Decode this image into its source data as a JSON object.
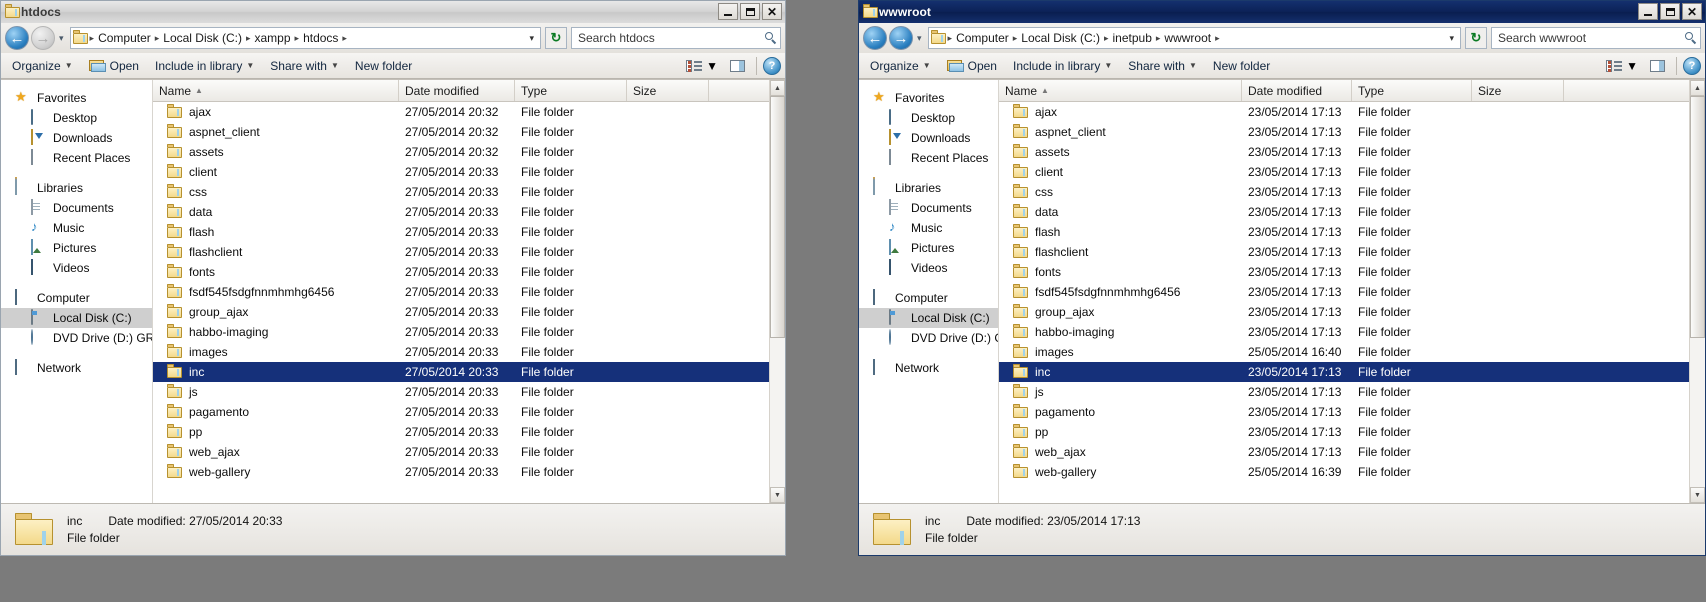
{
  "desktop": {
    "background": "#7b7b7b"
  },
  "windows": [
    {
      "id": "htdocs",
      "title": "htdocs",
      "active": false,
      "titlebar": {
        "minimize": "_",
        "maximize": "□",
        "close": "✕"
      },
      "address": {
        "back_label": "◀",
        "forward_label": "▶",
        "history_label": "▾",
        "crumbs": [
          "Computer",
          "Local Disk (C:)",
          "xampp",
          "htdocs"
        ],
        "separator": "▸",
        "dropdown_caret": "▾",
        "refresh_label": "↻"
      },
      "search": {
        "placeholder": "Search htdocs",
        "icon": "search-icon"
      },
      "toolbar": {
        "organize": "Organize",
        "open": "Open",
        "include_in_library": "Include in library",
        "share_with": "Share with",
        "new_folder": "New folder",
        "dropdown_caret": "▾",
        "view_icon": "view-list-icon",
        "preview_icon": "preview-pane-icon",
        "help_label": "?"
      },
      "navpane": {
        "groups": [
          {
            "name": "Favorites",
            "icon": "star-icon",
            "items": [
              {
                "label": "Desktop",
                "icon": "desktop-icon"
              },
              {
                "label": "Downloads",
                "icon": "downloads-icon"
              },
              {
                "label": "Recent Places",
                "icon": "recent-places-icon"
              }
            ]
          },
          {
            "name": "Libraries",
            "icon": "libraries-icon",
            "items": [
              {
                "label": "Documents",
                "icon": "documents-icon"
              },
              {
                "label": "Music",
                "icon": "music-icon"
              },
              {
                "label": "Pictures",
                "icon": "pictures-icon"
              },
              {
                "label": "Videos",
                "icon": "videos-icon"
              }
            ]
          },
          {
            "name": "Computer",
            "icon": "computer-icon",
            "items": [
              {
                "label": "Local Disk (C:)",
                "icon": "disk-icon",
                "selected": true
              },
              {
                "label": "DVD Drive (D:) GRMSX",
                "icon": "dvd-icon"
              }
            ]
          },
          {
            "name": "Network",
            "icon": "network-icon",
            "items": []
          }
        ]
      },
      "columns": [
        {
          "key": "name",
          "label": "Name",
          "sorted": true,
          "sort_arrow": "▲"
        },
        {
          "key": "date",
          "label": "Date modified"
        },
        {
          "key": "type",
          "label": "Type"
        },
        {
          "key": "size",
          "label": "Size"
        }
      ],
      "rows": [
        {
          "name": "ajax",
          "date": "27/05/2014 20:32",
          "type": "File folder",
          "size": ""
        },
        {
          "name": "aspnet_client",
          "date": "27/05/2014 20:32",
          "type": "File folder",
          "size": ""
        },
        {
          "name": "assets",
          "date": "27/05/2014 20:32",
          "type": "File folder",
          "size": ""
        },
        {
          "name": "client",
          "date": "27/05/2014 20:33",
          "type": "File folder",
          "size": ""
        },
        {
          "name": "css",
          "date": "27/05/2014 20:33",
          "type": "File folder",
          "size": ""
        },
        {
          "name": "data",
          "date": "27/05/2014 20:33",
          "type": "File folder",
          "size": ""
        },
        {
          "name": "flash",
          "date": "27/05/2014 20:33",
          "type": "File folder",
          "size": ""
        },
        {
          "name": "flashclient",
          "date": "27/05/2014 20:33",
          "type": "File folder",
          "size": ""
        },
        {
          "name": "fonts",
          "date": "27/05/2014 20:33",
          "type": "File folder",
          "size": ""
        },
        {
          "name": "fsdf545fsdgfnnmhmhg6456",
          "date": "27/05/2014 20:33",
          "type": "File folder",
          "size": ""
        },
        {
          "name": "group_ajax",
          "date": "27/05/2014 20:33",
          "type": "File folder",
          "size": ""
        },
        {
          "name": "habbo-imaging",
          "date": "27/05/2014 20:33",
          "type": "File folder",
          "size": ""
        },
        {
          "name": "images",
          "date": "27/05/2014 20:33",
          "type": "File folder",
          "size": ""
        },
        {
          "name": "inc",
          "date": "27/05/2014 20:33",
          "type": "File folder",
          "size": "",
          "selected": true
        },
        {
          "name": "js",
          "date": "27/05/2014 20:33",
          "type": "File folder",
          "size": ""
        },
        {
          "name": "pagamento",
          "date": "27/05/2014 20:33",
          "type": "File folder",
          "size": ""
        },
        {
          "name": "pp",
          "date": "27/05/2014 20:33",
          "type": "File folder",
          "size": ""
        },
        {
          "name": "web_ajax",
          "date": "27/05/2014 20:33",
          "type": "File folder",
          "size": ""
        },
        {
          "name": "web-gallery",
          "date": "27/05/2014 20:33",
          "type": "File folder",
          "size": ""
        }
      ],
      "details": {
        "name": "inc",
        "date_label": "Date modified:",
        "date_value": "27/05/2014 20:33",
        "type": "File folder"
      }
    },
    {
      "id": "wwwroot",
      "title": "wwwroot",
      "active": true,
      "titlebar": {
        "minimize": "_",
        "maximize": "□",
        "close": "✕"
      },
      "address": {
        "back_label": "◀",
        "forward_label": "▶",
        "history_label": "▾",
        "crumbs": [
          "Computer",
          "Local Disk (C:)",
          "inetpub",
          "wwwroot"
        ],
        "separator": "▸",
        "dropdown_caret": "▾",
        "refresh_label": "↻"
      },
      "search": {
        "placeholder": "Search wwwroot",
        "icon": "search-icon"
      },
      "toolbar": {
        "organize": "Organize",
        "open": "Open",
        "include_in_library": "Include in library",
        "share_with": "Share with",
        "new_folder": "New folder",
        "dropdown_caret": "▾",
        "view_icon": "view-list-icon",
        "preview_icon": "preview-pane-icon",
        "help_label": "?"
      },
      "navpane": {
        "groups": [
          {
            "name": "Favorites",
            "icon": "star-icon",
            "items": [
              {
                "label": "Desktop",
                "icon": "desktop-icon"
              },
              {
                "label": "Downloads",
                "icon": "downloads-icon"
              },
              {
                "label": "Recent Places",
                "icon": "recent-places-icon"
              }
            ]
          },
          {
            "name": "Libraries",
            "icon": "libraries-icon",
            "items": [
              {
                "label": "Documents",
                "icon": "documents-icon"
              },
              {
                "label": "Music",
                "icon": "music-icon"
              },
              {
                "label": "Pictures",
                "icon": "pictures-icon"
              },
              {
                "label": "Videos",
                "icon": "videos-icon"
              }
            ]
          },
          {
            "name": "Computer",
            "icon": "computer-icon",
            "items": [
              {
                "label": "Local Disk (C:)",
                "icon": "disk-icon",
                "selected": true
              },
              {
                "label": "DVD Drive (D:) GRMSX",
                "icon": "dvd-icon"
              }
            ]
          },
          {
            "name": "Network",
            "icon": "network-icon",
            "items": []
          }
        ]
      },
      "columns": [
        {
          "key": "name",
          "label": "Name",
          "sorted": true,
          "sort_arrow": "▲"
        },
        {
          "key": "date",
          "label": "Date modified"
        },
        {
          "key": "type",
          "label": "Type"
        },
        {
          "key": "size",
          "label": "Size"
        }
      ],
      "rows": [
        {
          "name": "ajax",
          "date": "23/05/2014 17:13",
          "type": "File folder",
          "size": ""
        },
        {
          "name": "aspnet_client",
          "date": "23/05/2014 17:13",
          "type": "File folder",
          "size": ""
        },
        {
          "name": "assets",
          "date": "23/05/2014 17:13",
          "type": "File folder",
          "size": ""
        },
        {
          "name": "client",
          "date": "23/05/2014 17:13",
          "type": "File folder",
          "size": ""
        },
        {
          "name": "css",
          "date": "23/05/2014 17:13",
          "type": "File folder",
          "size": ""
        },
        {
          "name": "data",
          "date": "23/05/2014 17:13",
          "type": "File folder",
          "size": ""
        },
        {
          "name": "flash",
          "date": "23/05/2014 17:13",
          "type": "File folder",
          "size": ""
        },
        {
          "name": "flashclient",
          "date": "23/05/2014 17:13",
          "type": "File folder",
          "size": ""
        },
        {
          "name": "fonts",
          "date": "23/05/2014 17:13",
          "type": "File folder",
          "size": ""
        },
        {
          "name": "fsdf545fsdgfnnmhmhg6456",
          "date": "23/05/2014 17:13",
          "type": "File folder",
          "size": ""
        },
        {
          "name": "group_ajax",
          "date": "23/05/2014 17:13",
          "type": "File folder",
          "size": ""
        },
        {
          "name": "habbo-imaging",
          "date": "23/05/2014 17:13",
          "type": "File folder",
          "size": ""
        },
        {
          "name": "images",
          "date": "25/05/2014 16:40",
          "type": "File folder",
          "size": ""
        },
        {
          "name": "inc",
          "date": "23/05/2014 17:13",
          "type": "File folder",
          "size": "",
          "selected": true
        },
        {
          "name": "js",
          "date": "23/05/2014 17:13",
          "type": "File folder",
          "size": ""
        },
        {
          "name": "pagamento",
          "date": "23/05/2014 17:13",
          "type": "File folder",
          "size": ""
        },
        {
          "name": "pp",
          "date": "23/05/2014 17:13",
          "type": "File folder",
          "size": ""
        },
        {
          "name": "web_ajax",
          "date": "23/05/2014 17:13",
          "type": "File folder",
          "size": ""
        },
        {
          "name": "web-gallery",
          "date": "25/05/2014 16:39",
          "type": "File folder",
          "size": ""
        }
      ],
      "details": {
        "name": "inc",
        "date_label": "Date modified:",
        "date_value": "23/05/2014 17:13",
        "type": "File folder"
      }
    }
  ],
  "colors": {
    "selection": "#15307a",
    "active_title": "#0c2258",
    "inactive_title": "#d3d3d3",
    "folder_yellow": "#f3d98a"
  }
}
